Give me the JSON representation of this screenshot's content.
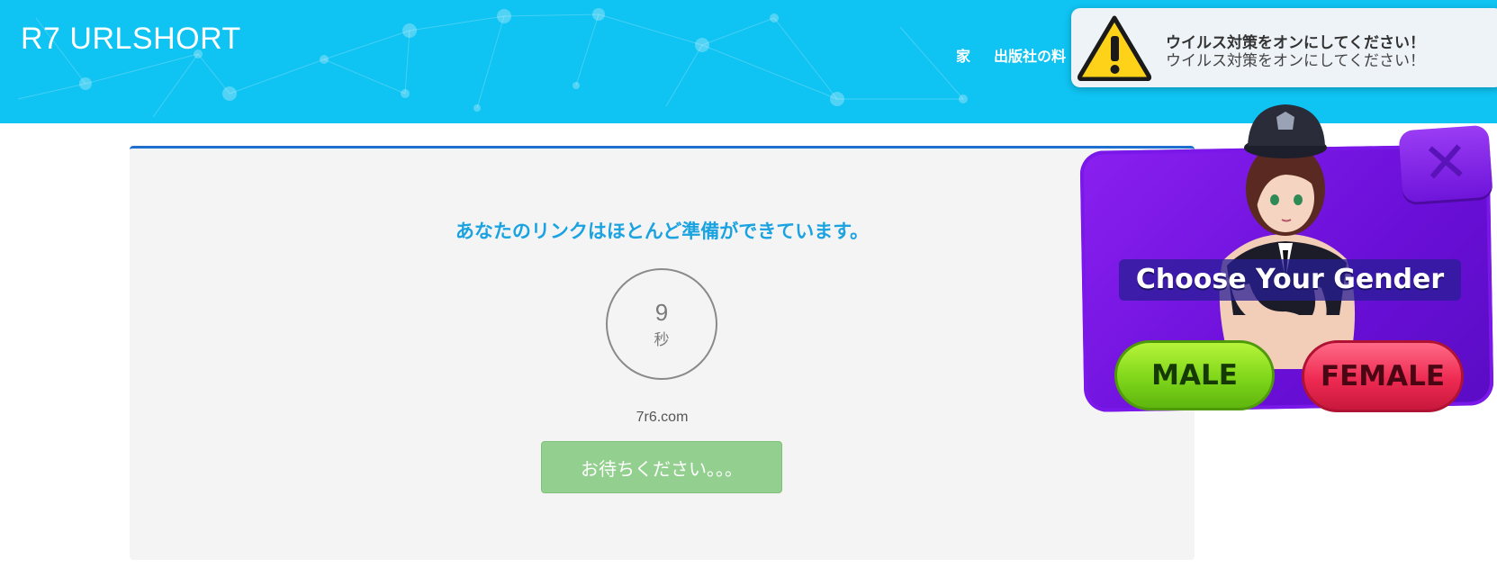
{
  "header": {
    "brand": "R7 URLSHORT",
    "nav": [
      {
        "label": "家"
      },
      {
        "label": "出版社の料"
      }
    ]
  },
  "main": {
    "headline": "あなたのリンクはほとんど準備ができています。",
    "timer_value": "9",
    "timer_unit": "秒",
    "domain": "7r6.com",
    "wait_button": "お待ちください。。。"
  },
  "toast": {
    "title": "ウイルス対策をオンにしてください！",
    "message": "ウイルス対策をオンにしてください！"
  },
  "ad": {
    "heading": "Choose Your Gender",
    "male_label": "MALE",
    "female_label": "FEMALE",
    "close_symbol": "✕"
  },
  "colors": {
    "header_bg": "#0fc3f2",
    "headline": "#1aa3e0",
    "wait_button": "#93d08f",
    "card_border": "#1f6fd1"
  }
}
